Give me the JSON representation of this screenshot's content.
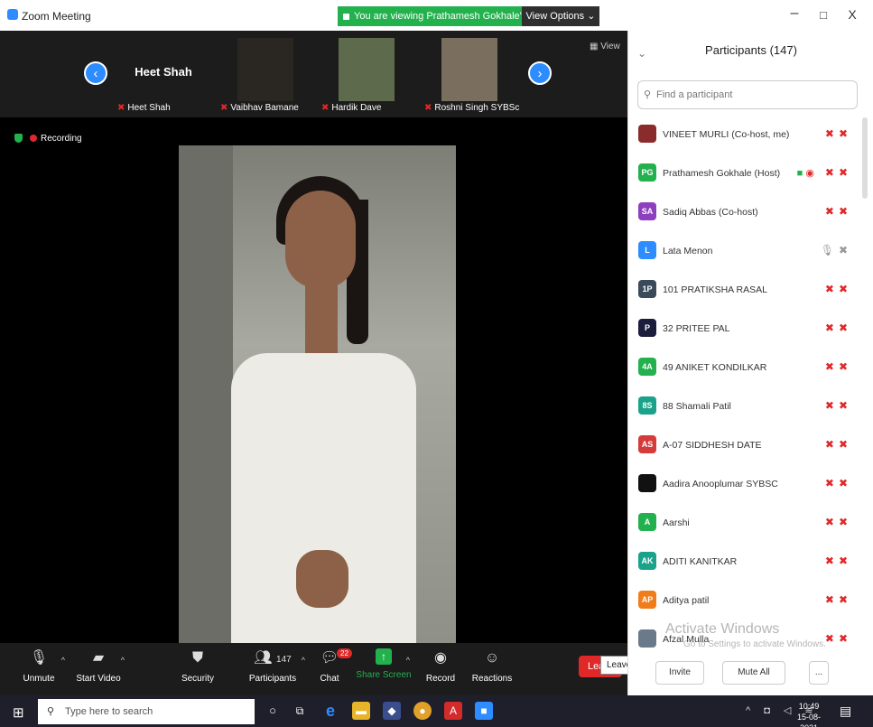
{
  "window": {
    "title": "Zoom Meeting",
    "minimize": "–",
    "restore": "□",
    "close": "X"
  },
  "banner": {
    "viewing_text": "You are viewing Prathamesh Gokhale's screen",
    "view_options": "View Options ⌄"
  },
  "thumbnails": {
    "active_speaker_big": "Heet Shah",
    "items": [
      {
        "name": "Heet Shah"
      },
      {
        "name": "Vaibhav Bamane"
      },
      {
        "name": "Hardik Dave"
      },
      {
        "name": "Roshni Singh SYBSc"
      }
    ],
    "view_label": "View"
  },
  "recording": {
    "label": "Recording"
  },
  "toolbar": {
    "unmute": "Unmute",
    "start_video": "Start Video",
    "security": "Security",
    "participants": "Participants",
    "participants_count": "147",
    "chat": "Chat",
    "chat_badge": "22",
    "share_screen": "Share Screen",
    "record": "Record",
    "reactions": "Reactions",
    "leave": "Lea",
    "leave_tooltip": "Leave (Alt+Q)"
  },
  "panel": {
    "title": "Participants (147)",
    "search_placeholder": "Find a participant",
    "participants": [
      {
        "initials": "",
        "name": "VINEET MURLI (Co-host, me)",
        "color": "#8b2c2c"
      },
      {
        "initials": "PG",
        "name": "Prathamesh Gokhale (Host)",
        "color": "#23b14d"
      },
      {
        "initials": "SA",
        "name": "Sadiq Abbas (Co-host)",
        "color": "#8e3fbf"
      },
      {
        "initials": "L",
        "name": "Lata Menon",
        "color": "#2d8cff"
      },
      {
        "initials": "1P",
        "name": "101 PRATIKSHA RASAL",
        "color": "#3a4a5a"
      },
      {
        "initials": "P",
        "name": "32 PRITEE PAL",
        "color": "#1c1c3c"
      },
      {
        "initials": "4A",
        "name": "49 ANIKET KONDILKAR",
        "color": "#23b14d"
      },
      {
        "initials": "8S",
        "name": "88 Shamali Patil",
        "color": "#1aa38a"
      },
      {
        "initials": "AS",
        "name": "A-07 SIDDHESH DATE",
        "color": "#d63b3b"
      },
      {
        "initials": "",
        "name": "Aadira Anooplumar SYBSC",
        "color": "#111111"
      },
      {
        "initials": "A",
        "name": "Aarshi",
        "color": "#23b14d"
      },
      {
        "initials": "AK",
        "name": "ADITI KANITKAR",
        "color": "#1aa38a"
      },
      {
        "initials": "AP",
        "name": "Aditya patil",
        "color": "#f07c1a"
      },
      {
        "initials": "",
        "name": "Afzal Mulla",
        "color": "#6a7a8a"
      }
    ],
    "invite": "Invite",
    "mute_all": "Mute All",
    "more": "..."
  },
  "watermark": {
    "line1": "Activate Windows",
    "line2": "Go to Settings to activate Windows."
  },
  "taskbar": {
    "search": "Type here to search",
    "time": "10:49",
    "date": "15-08-2021"
  }
}
